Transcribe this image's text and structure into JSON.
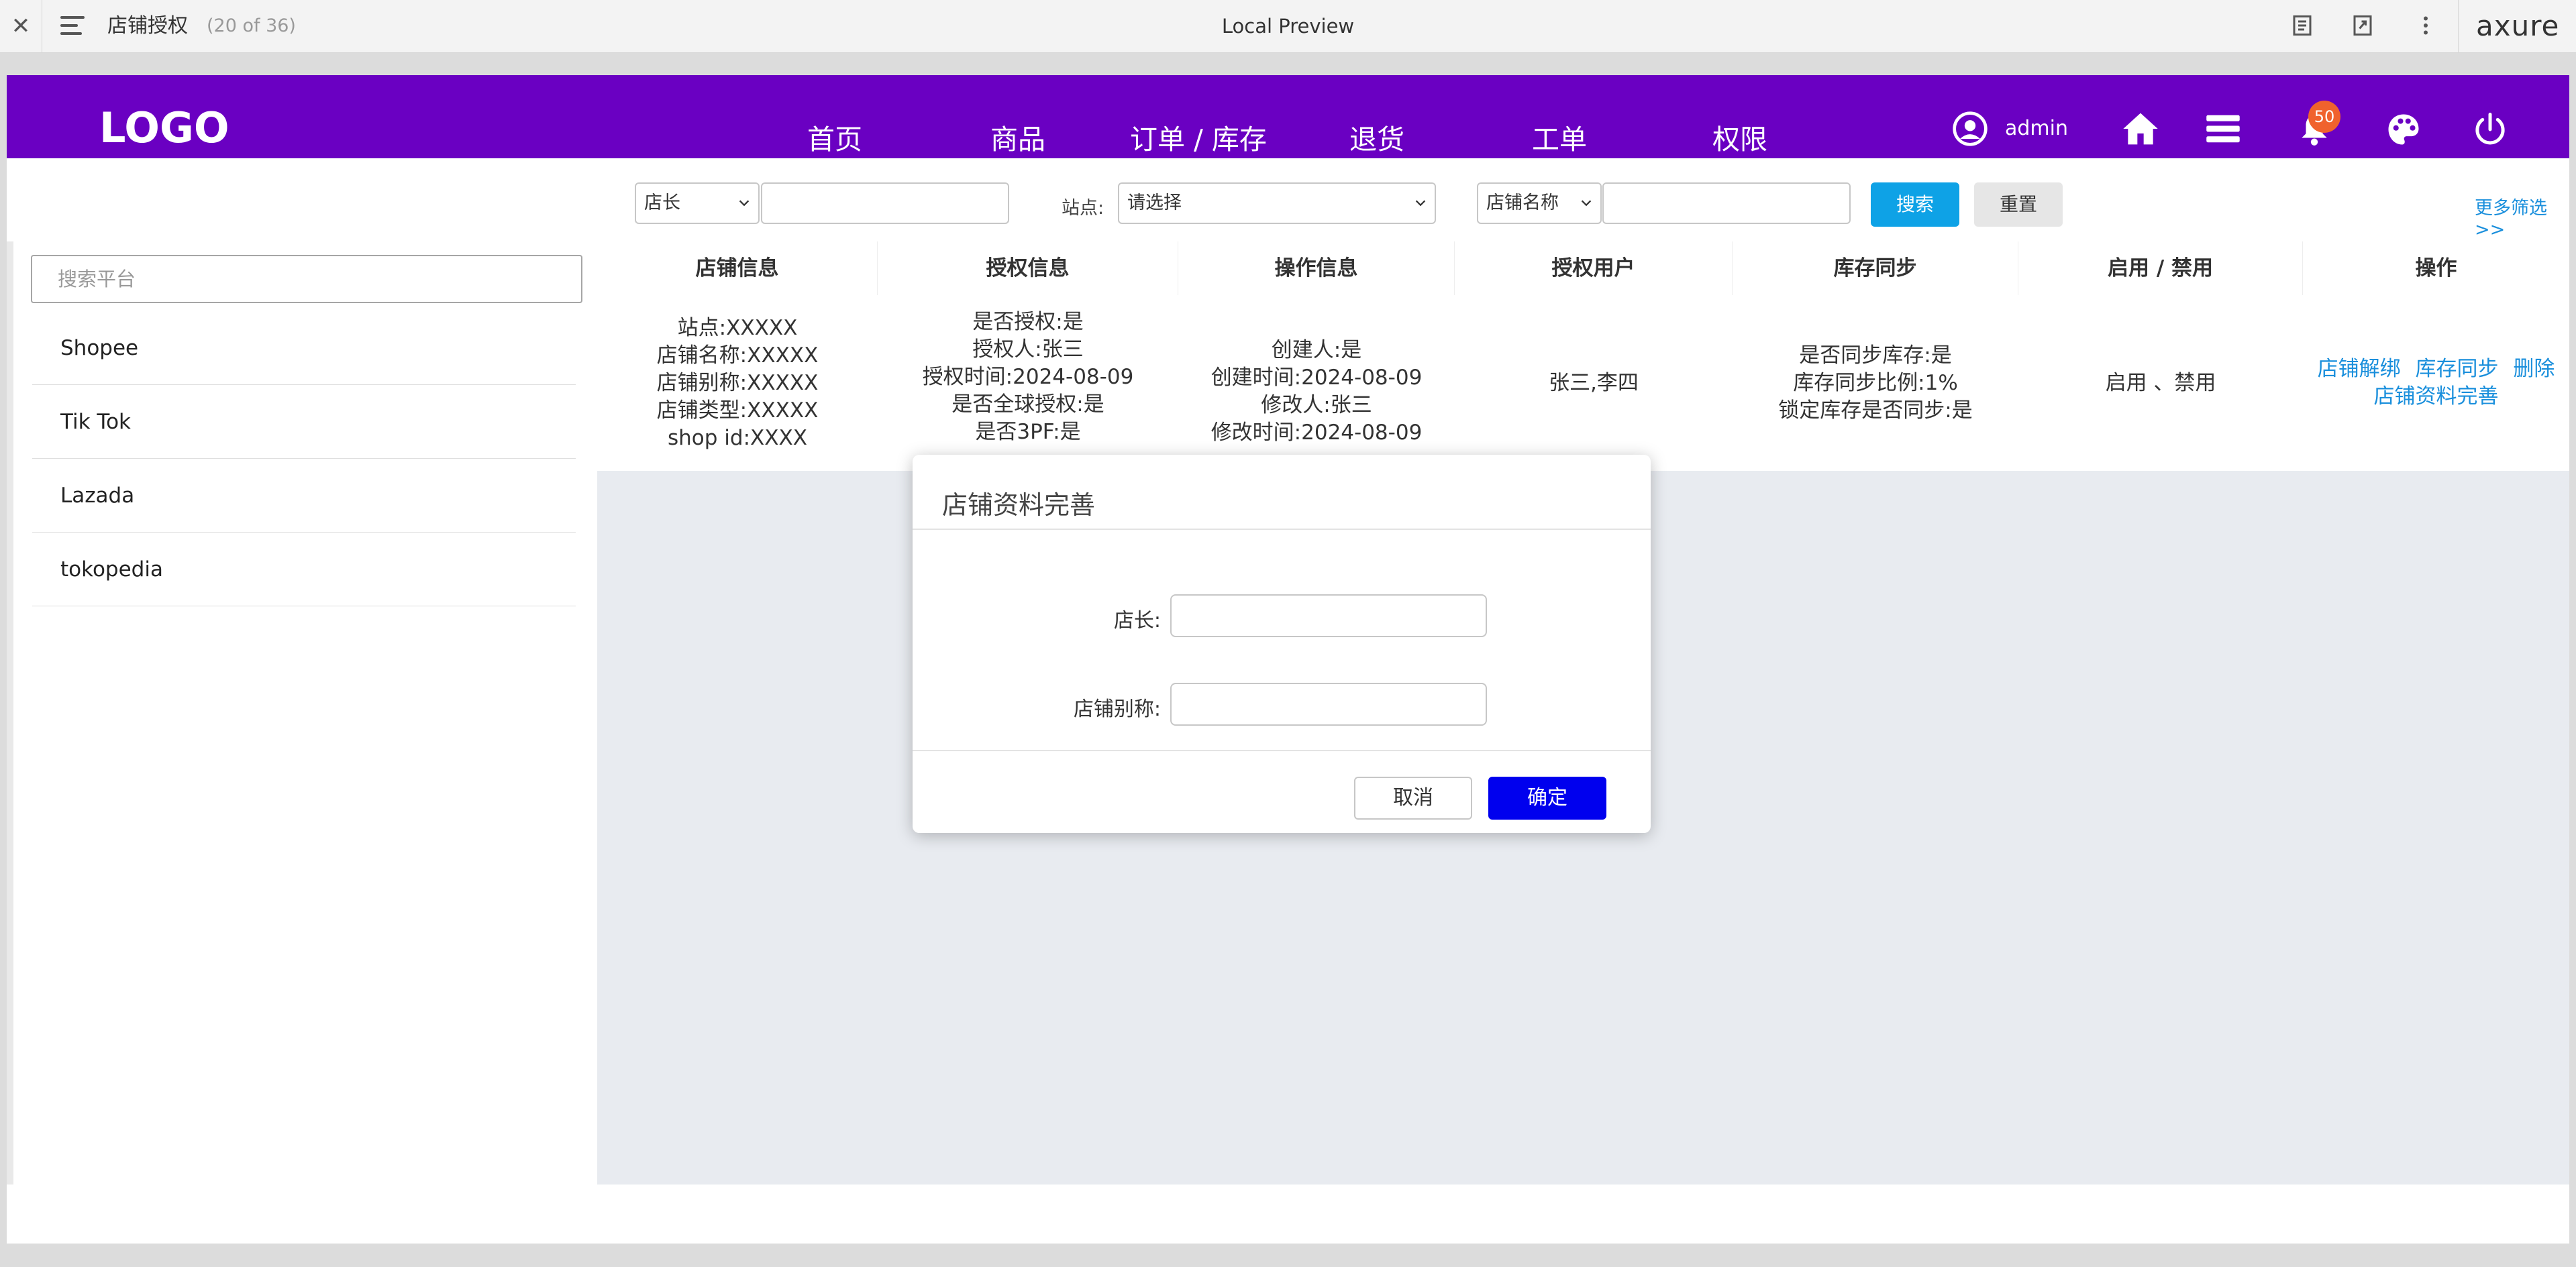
{
  "axure": {
    "close_glyph": "✕",
    "page_title": "店铺授权",
    "page_count": "(20 of 36)",
    "center_title": "Local Preview",
    "brand": "axure"
  },
  "nav": {
    "logo": "LOGO",
    "items": [
      "首页",
      "商品",
      "订单 / 库存",
      "退货",
      "工单",
      "权限"
    ],
    "user": "admin",
    "notification_count": "50",
    "bg_color": "#6a00c2"
  },
  "filters": {
    "select1": "店长",
    "station_label": "站点:",
    "station_select": "请选择",
    "select3": "店铺名称",
    "search_button": "搜索",
    "reset_button": "重置",
    "more": "更多筛选>>"
  },
  "sidebar": {
    "search_placeholder": "搜索平台",
    "platforms": [
      "Shopee",
      "Tik Tok",
      "Lazada",
      "tokopedia"
    ]
  },
  "table": {
    "headers": [
      "店铺信息",
      "授权信息",
      "操作信息",
      "授权用户",
      "库存同步",
      "启用 / 禁用",
      "操作"
    ],
    "row": {
      "shop_info": [
        "站点:XXXXX",
        "店铺名称:XXXXX",
        "店铺别称:XXXXX",
        "店铺类型:XXXXX",
        "shop id:XXXX"
      ],
      "auth_info": [
        "是否授权:是",
        "授权人:张三",
        "授权时间:2024-08-09",
        "是否全球授权:是",
        "是否3PF:是"
      ],
      "op_info": [
        "创建人:是",
        "创建时间:2024-08-09",
        "修改人:张三",
        "修改时间:2024-08-09"
      ],
      "auth_users": "张三,李四",
      "stock_sync": [
        "是否同步库存:是",
        "库存同步比例:1%",
        "锁定库存是否同步:是"
      ],
      "enable": "启用 、禁用",
      "actions": [
        "店铺解绑",
        "库存同步",
        "删除",
        "店铺资料完善"
      ]
    }
  },
  "modal": {
    "title": "店铺资料完善",
    "field1_label": "店长:",
    "field2_label": "店铺别称:",
    "cancel": "取消",
    "confirm": "确定",
    "confirm_color": "#0000ee"
  }
}
